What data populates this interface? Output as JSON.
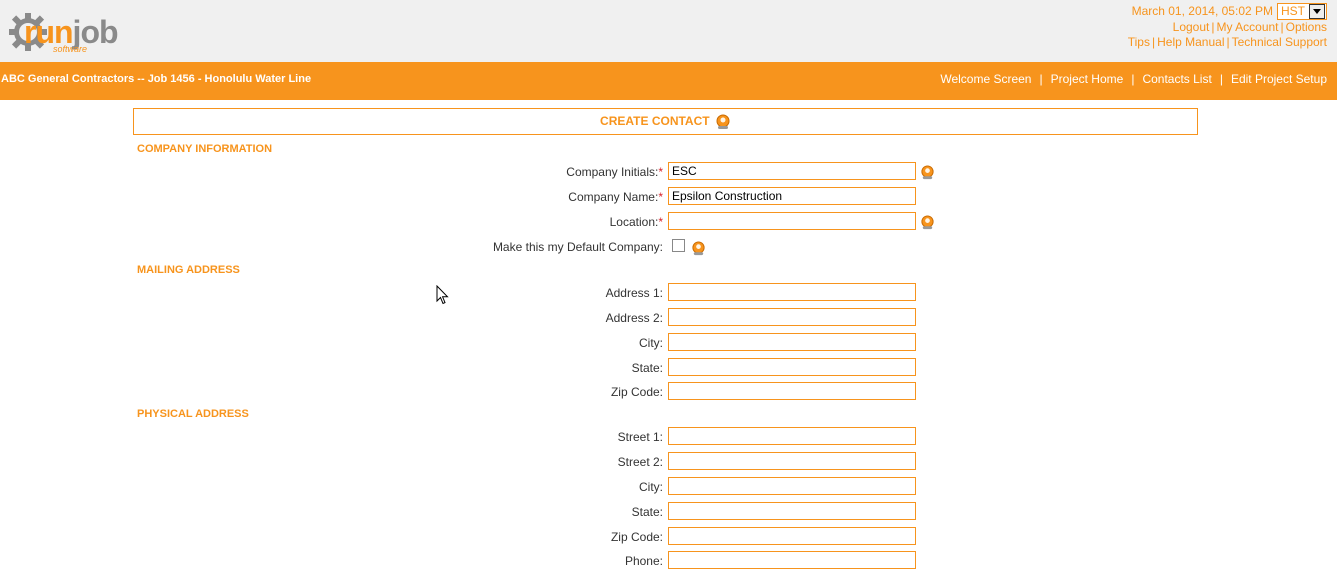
{
  "header": {
    "logo_main_left": "run",
    "logo_main_right": "job",
    "logo_sub": "software",
    "datetime": "March 01, 2014, 05:02 PM",
    "timezone": "HST",
    "links_row1": [
      "Logout",
      "My Account",
      "Options"
    ],
    "links_row2": [
      "Tips",
      "Help Manual",
      "Technical Support"
    ]
  },
  "navbar": {
    "project_title": "ABC General Contractors -- Job 1456 - Honolulu Water Line",
    "links": [
      "Welcome Screen",
      "Project Home",
      "Contacts List",
      "Edit Project Setup"
    ]
  },
  "form": {
    "title": "CREATE CONTACT",
    "company_section": "COMPANY INFORMATION",
    "company_fields": {
      "initials_label": "Company Initials:",
      "initials_value": "ESC",
      "name_label": "Company Name:",
      "name_value": "Epsilon Construction",
      "location_label": "Location:",
      "location_value": "",
      "default_label": "Make this my Default Company:"
    },
    "required_mark": "*",
    "mailing_section": "MAILING ADDRESS",
    "mailing_fields": [
      "Address 1:",
      "Address 2:",
      "City:",
      "State:",
      "Zip Code:"
    ],
    "physical_section": "PHYSICAL ADDRESS",
    "physical_fields": [
      "Street 1:",
      "Street 2:",
      "City:",
      "State:",
      "Zip Code:",
      "Phone:"
    ]
  },
  "colors": {
    "accent": "#f7941d",
    "required": "#d9222a",
    "header_bg": "#f0f0f0"
  }
}
